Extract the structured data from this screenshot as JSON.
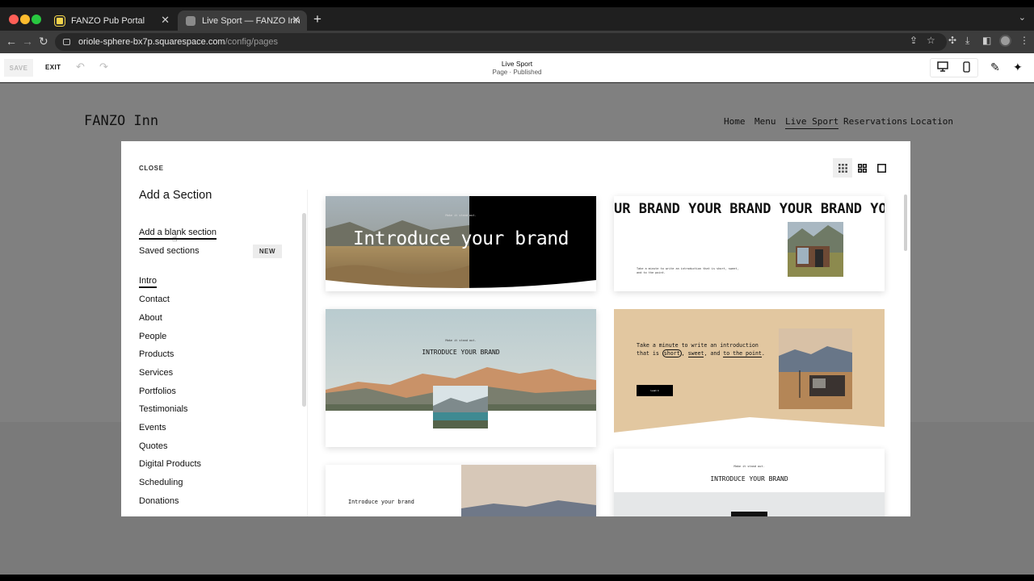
{
  "browser": {
    "tabs": [
      {
        "title": "FANZO Pub Portal"
      },
      {
        "title": "Live Sport — FANZO Inn"
      }
    ],
    "url_host": "oriole-sphere-bx7p.squarespace.com",
    "url_path": "/config/pages"
  },
  "editor": {
    "save_label": "SAVE",
    "exit_label": "EXIT",
    "page_title": "Live Sport",
    "page_status": "Page · Published"
  },
  "site": {
    "logo": "FANZO Inn",
    "nav": [
      "Home",
      "Menu",
      "Live Sport",
      "Reservations",
      "Location"
    ],
    "active_nav": "Live Sport"
  },
  "modal": {
    "close_label": "CLOSE",
    "title": "Add a Section",
    "blank_section": "Add a blank section",
    "saved_sections": "Saved sections",
    "new_badge": "NEW",
    "categories": [
      "Intro",
      "Contact",
      "About",
      "People",
      "Products",
      "Services",
      "Portfolios",
      "Testimonials",
      "Events",
      "Quotes",
      "Digital Products",
      "Scheduling",
      "Donations"
    ],
    "selected_category": "Intro"
  },
  "templates": {
    "t1": {
      "kicker": "Make it stand out.",
      "headline": "Introduce your brand"
    },
    "t2": {
      "marquee": "UR BRAND YOUR BRAND YOUR BRAND YOU",
      "body": "Take a minute to write an introduction that is short, sweet, and to the point."
    },
    "t3": {
      "kicker": "Make it stand out.",
      "headline": "INTRODUCE YOUR BRAND"
    },
    "t4": {
      "body_line1": "Take a minute to write an introduction",
      "body_pre": "that is ",
      "word_short": "short",
      "word_sweet": "sweet",
      "body_mid": ", and ",
      "word_point": "to the point",
      "body_end": ".",
      "button": "Learn it"
    },
    "t5": {
      "headline": "Introduce your brand"
    },
    "t6": {
      "kicker": "Make it stand out.",
      "headline": "INTRODUCE YOUR BRAND"
    }
  },
  "colors": {
    "accent_beige": "#e2c7a0",
    "chrome_dark": "#1f1f1f",
    "overlay_gray": "#808080"
  }
}
